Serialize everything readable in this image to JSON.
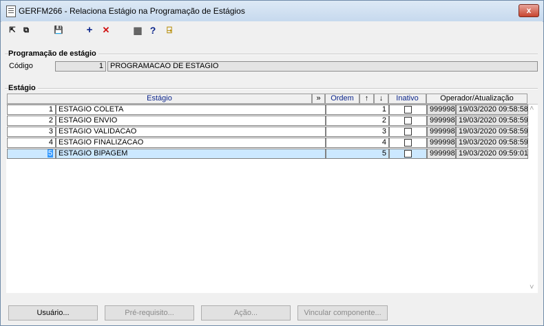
{
  "window": {
    "title": "GERFM266 - Relaciona Estágio na Programação de Estágios",
    "close_label": "x"
  },
  "toolbar": {
    "items": [
      {
        "name": "first-record-icon",
        "glyph": "⇱"
      },
      {
        "name": "copy-icon",
        "glyph": "⧉"
      },
      {
        "name": "save-icon",
        "glyph": "💾"
      },
      {
        "name": "add-icon",
        "glyph": "+"
      },
      {
        "name": "delete-icon",
        "glyph": "✕"
      },
      {
        "name": "calendar-icon",
        "glyph": "▦"
      },
      {
        "name": "help-icon",
        "glyph": "?"
      },
      {
        "name": "exit-icon",
        "glyph": "⍈"
      }
    ]
  },
  "programacao": {
    "group_title": "Programação de estágio",
    "codigo_label": "Código",
    "codigo_value": "1",
    "descricao_value": "PROGRAMACAO DE ESTAGIO"
  },
  "estagio": {
    "group_title": "Estágio",
    "headers": {
      "estagio": "Estágio",
      "expand": "»",
      "ordem": "Ordem",
      "up": "↑",
      "down": "↓",
      "inativo": "Inativo",
      "operador": "Operador/Atualização"
    },
    "rows": [
      {
        "cod": "1",
        "nome": "ESTAGIO COLETA",
        "ordem": "1",
        "inativo": false,
        "operador": "999998",
        "data": "19/03/2020 09:58:58"
      },
      {
        "cod": "2",
        "nome": "ESTAGIO ENVIO",
        "ordem": "2",
        "inativo": false,
        "operador": "999998",
        "data": "19/03/2020 09:58:59"
      },
      {
        "cod": "3",
        "nome": "ESTAGIO VALIDACAO",
        "ordem": "3",
        "inativo": false,
        "operador": "999998",
        "data": "19/03/2020 09:58:59"
      },
      {
        "cod": "4",
        "nome": "ESTAGIO FINALIZACAO",
        "ordem": "4",
        "inativo": false,
        "operador": "999998",
        "data": "19/03/2020 09:58:59"
      },
      {
        "cod": "5",
        "nome": "ESTAGIO BIPAGEM",
        "ordem": "5",
        "inativo": false,
        "operador": "999998",
        "data": "19/03/2020 09:59:01"
      }
    ],
    "selected_row": 5,
    "scroll_up": "˄",
    "scroll_down": "˅"
  },
  "buttons": {
    "usuario": "Usuário...",
    "pre_requisito": "Pré-requisito...",
    "acao": "Ação...",
    "vincular": "Vincular componente..."
  }
}
